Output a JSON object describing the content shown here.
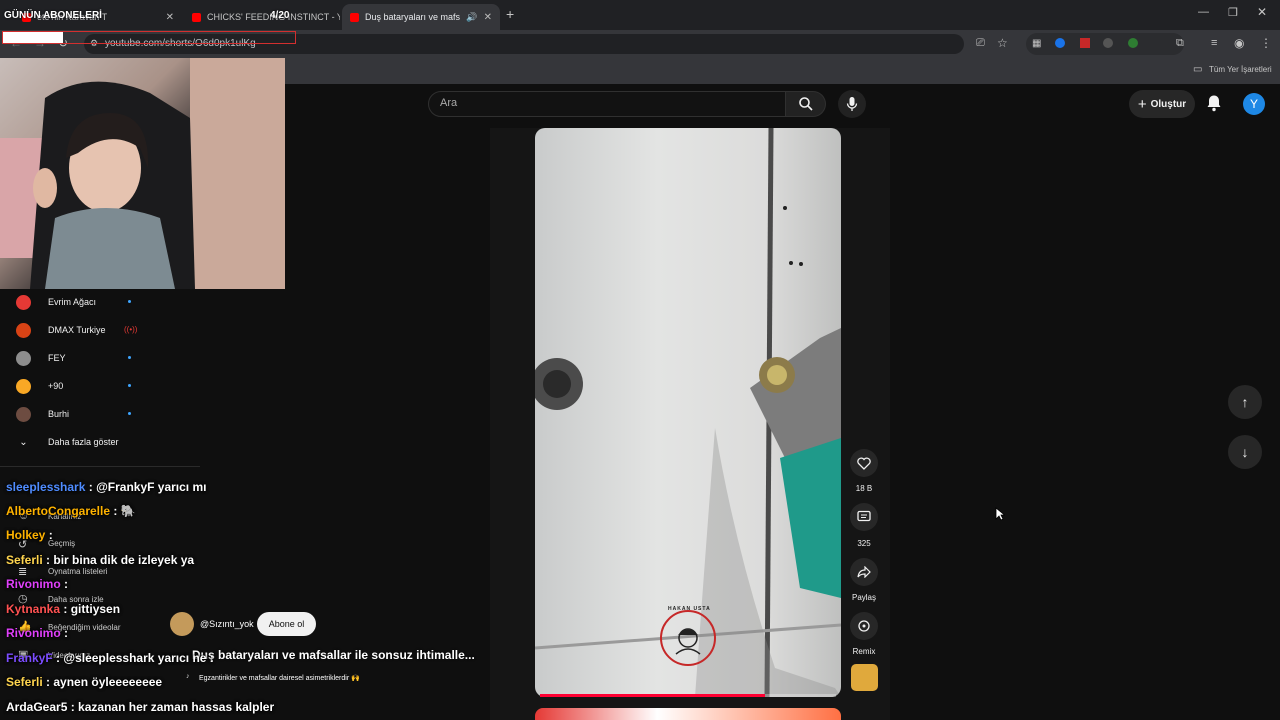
{
  "browser": {
    "tabs": [
      {
        "label": "ete'nin Karavan T"
      },
      {
        "label": "CHICKS' FEEDING INSTINCT - Y"
      },
      {
        "label": "Duş bataryaları ve mafs"
      }
    ],
    "url": "youtube.com/shorts/O6d0pk1ulKg",
    "bookmarks_label": "Tüm Yer İşaretleri"
  },
  "overlay": {
    "subs_title": "GÜNÜN ABONELERİ",
    "subs_count": "4/20"
  },
  "youtube": {
    "search_placeholder": "Ara",
    "create_label": "Oluştur",
    "avatar_letter": "Y",
    "sidebar": {
      "subscriptions": [
        {
          "name": "Evrim Ağacı",
          "color": "#e53935",
          "live": false
        },
        {
          "name": "DMAX Turkiye",
          "color": "#d84315",
          "live": true
        },
        {
          "name": "FEY",
          "color": "#8d8d8d",
          "live": false
        },
        {
          "name": "+90",
          "color": "#f9a825",
          "live": false
        },
        {
          "name": "Burhi",
          "color": "#6d4c41",
          "live": false
        }
      ],
      "show_more": "Daha fazla göster",
      "library_items": [
        "Kanalınız",
        "Geçmiş",
        "Oynatma listeleri",
        "Daha sonra izle",
        "Beğendiğim videolar",
        "Videolarınız"
      ]
    },
    "short": {
      "channel": "@Sızıntı_yok",
      "subscribe_label": "Abone ol",
      "title": "Duş bataryaları ve mafsallar ile sonsuz ihtimalle...",
      "subtitle": "Egzantirikler ve mafsallar dairesel asimetriklerdir 🙌",
      "watermark": "HAKAN USTA",
      "progress": 0.76
    },
    "actions": {
      "likes": "18 B",
      "comments": "325",
      "share": "Paylaş",
      "remix": "Remix"
    }
  },
  "chat": [
    {
      "user": "sleeplesshark",
      "color": "#4f8cff",
      "text": ": @FrankyF yarıcı mı"
    },
    {
      "user": "AlbertoCongarelle",
      "color": "#ffb300",
      "text": ": 🐘"
    },
    {
      "user": "Holkey",
      "color": "#ffb300",
      "text": ":"
    },
    {
      "user": "Seferli",
      "color": "#ffd54f",
      "text": ": bir bina dik de izleyek ya"
    },
    {
      "user": "Rivonimo",
      "color": "#e040fb",
      "text": ":"
    },
    {
      "user": "Kytnanka",
      "color": "#ff5252",
      "text": ": gittiysen"
    },
    {
      "user": "Rivonimo",
      "color": "#e040fb",
      "text": ":"
    },
    {
      "user": "FrankyF",
      "color": "#7c4dff",
      "text": ": @sleeplesshark yarıcı ne :"
    },
    {
      "user": "Seferli",
      "color": "#ffd54f",
      "text": ": aynen öyleeeeeeee"
    },
    {
      "user": "ArdaGear5",
      "color": "#ffffff",
      "text": ": kazanan her zaman hassas kalpler"
    }
  ],
  "colors": {
    "accent": "#ff0000",
    "link": "#3ea6ff"
  }
}
